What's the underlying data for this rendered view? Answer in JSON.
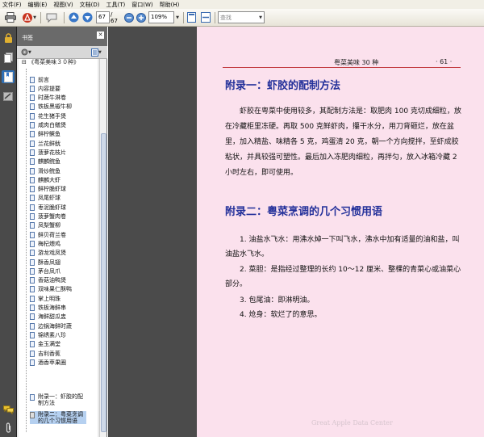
{
  "menu": [
    "文件(F)",
    "编辑(E)",
    "视图(V)",
    "文档(D)",
    "工具(T)",
    "窗口(W)",
    "帮助(H)"
  ],
  "toolbar": {
    "page_current": "67",
    "page_total": "/ 67",
    "zoom": "109%",
    "search_placeholder": "查找"
  },
  "panel": {
    "title": "书签",
    "parent": "《粤菜美味３０种》",
    "items": [
      "前言",
      "内容提要",
      "时蔬牛淋卷",
      "铁板黑椒牛柳",
      "花生猪手煲",
      "咸肉白鳝煲",
      "鲜柠鳜鱼",
      "兰花鲜鱿",
      "菠萝花枝片",
      "麒麟鲩鱼",
      "滑炒鲩鱼",
      "麒麟大虾",
      "鲜柠脆虾球",
      "凤尾虾球",
      "枣泥脆虾球",
      "菠萝蟹肉卷",
      "凤梨蟹柳",
      "鲜贝荷兰卷",
      "梅杞煨鸡",
      "游龙戏凤煲",
      "酥香凤翅",
      "茅台凤爪",
      "香菇油鸭煲",
      "双味果仁酥鸭",
      "掌上明珠",
      "铁板海鲜串",
      "海鲜甜瓜盅",
      "边锅海鲜时蔬",
      "锦绣素八珍",
      "金玉满堂",
      "吉利香蕉",
      "酒香苹果圈"
    ],
    "item_a1": "附录一：虾胶的配制方法",
    "item_a2": "附录二：粤菜烹调的几个习惯用语"
  },
  "page": {
    "running_title": "粤菜美味 30 种",
    "page_number": "· 61 ·",
    "appendix1_title": "附录一：虾胶的配制方法",
    "appendix1_body": "虾胶在粤菜中使用较多，其配制方法是：取肥肉 100 克切成细粒，放在冷藏柜里冻硬。再取 500 克鲜虾肉，攥干水分，用刀背砸烂，放在盆里，加入精盐、味精各 5 克，鸡蛋清 20 克，朝一个方向搅拌，至虾成胶粘状，并具较强可塑性。最后加入冻肥肉细粒，再拌匀，放入冰箱冷藏 2 小时左右，即可使用。",
    "appendix2_title": "附录二：粤菜烹调的几个习惯用语",
    "terms": [
      "1. 油盐水飞水：用沸水焯一下叫飞水，沸水中加有适量的油和盐，叫油盐水飞水。",
      "2. 菜胆：是指经过整理的长约 10～12 厘米、整棵的青菜心或油菜心部分。",
      "3. 包尾油：即淋明油。",
      "4. 炝身：软烂了的意思。"
    ],
    "watermark": "Great Apple Data Center"
  }
}
